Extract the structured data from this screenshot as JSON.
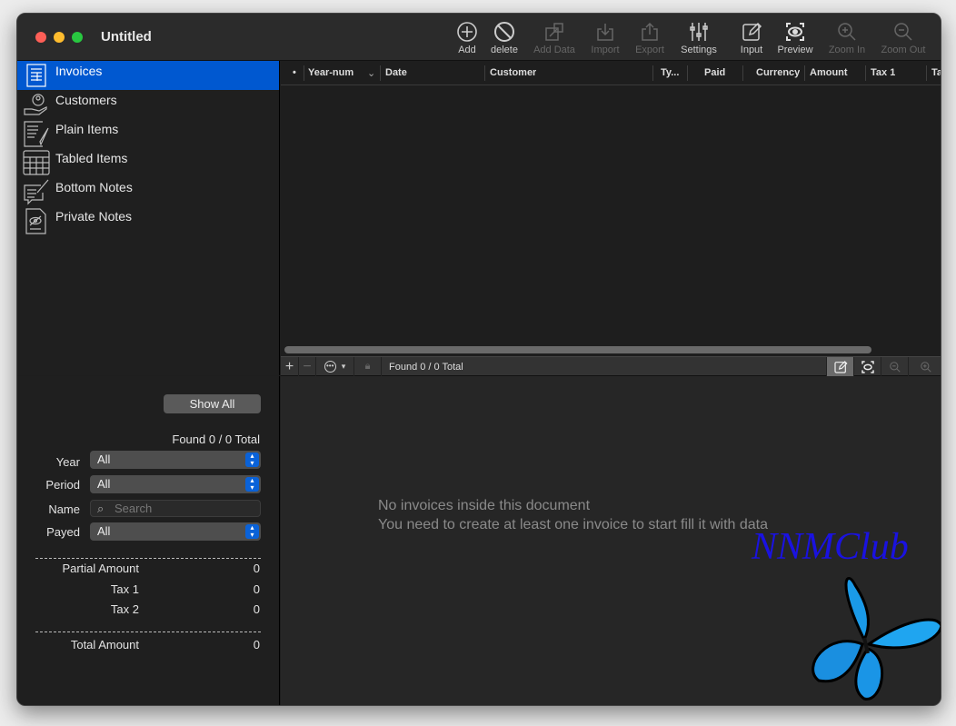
{
  "window": {
    "title": "Untitled"
  },
  "toolbar": [
    {
      "label": "Add",
      "icon": "plus-circle-icon",
      "enabled": true
    },
    {
      "label": "delete",
      "icon": "prohibited-icon",
      "enabled": true
    },
    {
      "label": "Add Data",
      "icon": "add-data-icon",
      "enabled": false
    },
    {
      "label": "Import",
      "icon": "import-icon",
      "enabled": false
    },
    {
      "label": "Export",
      "icon": "export-icon",
      "enabled": false
    },
    {
      "label": "Settings",
      "icon": "sliders-icon",
      "enabled": true
    },
    {
      "label": "Input",
      "icon": "edit-icon",
      "enabled": true
    },
    {
      "label": "Preview",
      "icon": "eye-icon",
      "enabled": true
    },
    {
      "label": "Zoom In",
      "icon": "zoom-in-icon",
      "enabled": false
    },
    {
      "label": "Zoom Out",
      "icon": "zoom-out-icon",
      "enabled": false
    }
  ],
  "sidebar": {
    "items": [
      {
        "label": "Invoices",
        "selected": true
      },
      {
        "label": "Customers"
      },
      {
        "label": "Plain Items"
      },
      {
        "label": "Tabled Items"
      },
      {
        "label": "Bottom Notes"
      },
      {
        "label": "Private Notes"
      }
    ]
  },
  "table": {
    "columns": [
      "•",
      "Year-num",
      "Date",
      "Customer",
      "Ty...",
      "Paid",
      "Currency",
      "Amount",
      "Tax 1",
      "Ta"
    ],
    "rows": []
  },
  "bottombar": {
    "status": "Found 0 / 0 Total"
  },
  "filters": {
    "show_all": "Show All",
    "found": "Found 0 / 0 Total",
    "year_label": "Year",
    "year_value": "All",
    "period_label": "Period",
    "period_value": "All",
    "name_label": "Name",
    "name_placeholder": "Search",
    "payed_label": "Payed",
    "payed_value": "All"
  },
  "totals": {
    "dashes": "------------------------------------------------",
    "partial_label": "Partial Amount",
    "partial_value": "0",
    "tax1_label": "Tax 1",
    "tax1_value": "0",
    "tax2_label": "Tax 2",
    "tax2_value": "0",
    "total_label": "Total Amount",
    "total_value": "0"
  },
  "preview": {
    "line1": "No invoices inside this document",
    "line2": "You need to create at least one invoice to start fill it with data"
  },
  "watermark": {
    "text": "NNMClub"
  },
  "colors": {
    "accent": "#0058d0",
    "watermark": "#1a12e0"
  }
}
